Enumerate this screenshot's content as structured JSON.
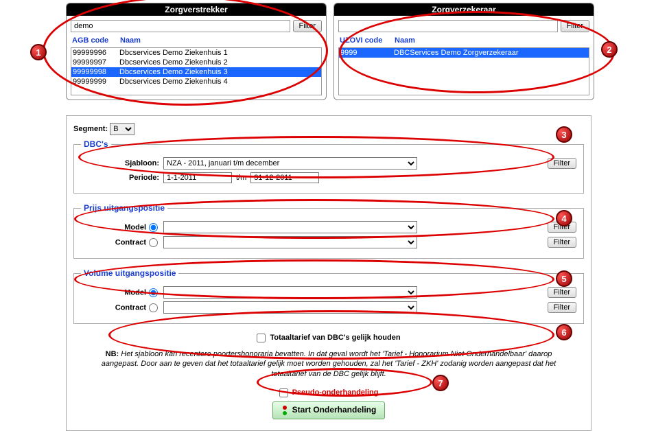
{
  "panel1": {
    "title": "Zorgverstrekker",
    "filter_value": "demo",
    "filter_btn": "Filter",
    "col1": "AGB code",
    "col2": "Naam",
    "rows": [
      {
        "code": "99999996",
        "naam": "Dbcservices Demo Ziekenhuis 1"
      },
      {
        "code": "99999997",
        "naam": "Dbcservices Demo Ziekenhuis 2"
      },
      {
        "code": "99999998",
        "naam": "Dbcservices Demo Ziekenhuis 3"
      },
      {
        "code": "99999999",
        "naam": "Dbcservices Demo Ziekenhuis 4"
      }
    ]
  },
  "panel2": {
    "title": "Zorgverzekeraar",
    "filter_value": "",
    "filter_btn": "Filter",
    "col1": "UZOVI code",
    "col2": "Naam",
    "rows": [
      {
        "code": "9999",
        "naam": "DBCServices Demo Zorgverzekeraar"
      }
    ]
  },
  "segment": {
    "label": "Segment:",
    "value": "B"
  },
  "dbcs": {
    "legend": "DBC's",
    "sjabloon_label": "Sjabloon:",
    "sjabloon_value": "NZA - 2011, januari t/m december",
    "filter_btn": "Filter",
    "periode_label": "Periode:",
    "periode_from": "1-1-2011",
    "periode_sep": "t/m",
    "periode_to": "31-12-2011"
  },
  "prijs": {
    "legend": "Prijs uitgangspositie",
    "model_label": "Model",
    "contract_label": "Contract",
    "filter_btn": "Filter"
  },
  "volume": {
    "legend": "Volume uitgangspositie",
    "model_label": "Model",
    "contract_label": "Contract",
    "filter_btn": "Filter"
  },
  "totaal": {
    "checkbox_label": "Totaaltarief van DBC's gelijk houden",
    "nb_label": "NB:",
    "nb_text": "Het sjabloon kan recentere poortershonoraria bevatten. In dat geval wordt het 'Tarief - Honorarium Niet Onderhandelbaar' daarop aangepast. Door aan te geven dat het totaaltarief gelijk moet worden gehouden, zal het 'Tarief - ZKH' zodanig worden aangepast dat het totaaltarief van de DBC gelijk blijft."
  },
  "start": {
    "pseudo_label": "Pseudo-onderhandeling",
    "button_label": "Start Onderhandeling"
  },
  "badges": [
    "1",
    "2",
    "3",
    "4",
    "5",
    "6",
    "7"
  ]
}
